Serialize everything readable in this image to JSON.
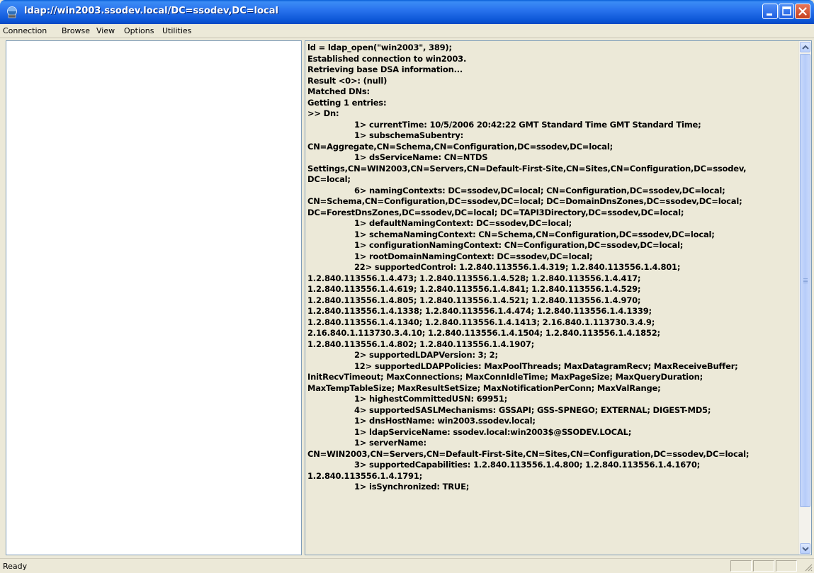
{
  "window": {
    "title": "ldap://win2003.ssodev.local/DC=ssodev,DC=local",
    "app_icon": "ldp-icon"
  },
  "menu": {
    "items": [
      "Connection",
      "Browse",
      "View",
      "Options",
      "Utilities"
    ]
  },
  "output": {
    "lines": [
      {
        "text": "ld = ldap_open(\"win2003\", 389);",
        "indent": false
      },
      {
        "text": "Established connection to win2003.",
        "indent": false
      },
      {
        "text": "Retrieving base DSA information...",
        "indent": false
      },
      {
        "text": "Result <0>: (null)",
        "indent": false
      },
      {
        "text": "Matched DNs:",
        "indent": false
      },
      {
        "text": "Getting 1 entries:",
        "indent": false
      },
      {
        "text": ">> Dn:",
        "indent": false
      },
      {
        "text": "1> currentTime: 10/5/2006 20:42:22 GMT Standard Time GMT Standard Time;",
        "indent": true
      },
      {
        "text": "1> subschemaSubentry:",
        "indent": true
      },
      {
        "text": "CN=Aggregate,CN=Schema,CN=Configuration,DC=ssodev,DC=local;",
        "indent": false
      },
      {
        "text": "1> dsServiceName: CN=NTDS",
        "indent": true
      },
      {
        "text": "Settings,CN=WIN2003,CN=Servers,CN=Default-First-Site,CN=Sites,CN=Configuration,DC=ssodev,",
        "indent": false
      },
      {
        "text": "DC=local;",
        "indent": false
      },
      {
        "text": "6> namingContexts: DC=ssodev,DC=local; CN=Configuration,DC=ssodev,DC=local;",
        "indent": true
      },
      {
        "text": "CN=Schema,CN=Configuration,DC=ssodev,DC=local; DC=DomainDnsZones,DC=ssodev,DC=local;",
        "indent": false
      },
      {
        "text": "DC=ForestDnsZones,DC=ssodev,DC=local; DC=TAPI3Directory,DC=ssodev,DC=local;",
        "indent": false
      },
      {
        "text": "1> defaultNamingContext: DC=ssodev,DC=local;",
        "indent": true
      },
      {
        "text": "1> schemaNamingContext: CN=Schema,CN=Configuration,DC=ssodev,DC=local;",
        "indent": true
      },
      {
        "text": "1> configurationNamingContext: CN=Configuration,DC=ssodev,DC=local;",
        "indent": true
      },
      {
        "text": "1> rootDomainNamingContext: DC=ssodev,DC=local;",
        "indent": true
      },
      {
        "text": "22> supportedControl: 1.2.840.113556.1.4.319; 1.2.840.113556.1.4.801;",
        "indent": true
      },
      {
        "text": "1.2.840.113556.1.4.473; 1.2.840.113556.1.4.528; 1.2.840.113556.1.4.417;",
        "indent": false
      },
      {
        "text": "1.2.840.113556.1.4.619; 1.2.840.113556.1.4.841; 1.2.840.113556.1.4.529;",
        "indent": false
      },
      {
        "text": "1.2.840.113556.1.4.805; 1.2.840.113556.1.4.521; 1.2.840.113556.1.4.970;",
        "indent": false
      },
      {
        "text": "1.2.840.113556.1.4.1338; 1.2.840.113556.1.4.474; 1.2.840.113556.1.4.1339;",
        "indent": false
      },
      {
        "text": "1.2.840.113556.1.4.1340; 1.2.840.113556.1.4.1413; 2.16.840.1.113730.3.4.9;",
        "indent": false
      },
      {
        "text": "2.16.840.1.113730.3.4.10; 1.2.840.113556.1.4.1504; 1.2.840.113556.1.4.1852;",
        "indent": false
      },
      {
        "text": "1.2.840.113556.1.4.802; 1.2.840.113556.1.4.1907;",
        "indent": false
      },
      {
        "text": "2> supportedLDAPVersion: 3; 2;",
        "indent": true
      },
      {
        "text": "12> supportedLDAPPolicies: MaxPoolThreads; MaxDatagramRecv; MaxReceiveBuffer;",
        "indent": true
      },
      {
        "text": "InitRecvTimeout; MaxConnections; MaxConnIdleTime; MaxPageSize; MaxQueryDuration;",
        "indent": false
      },
      {
        "text": "MaxTempTableSize; MaxResultSetSize; MaxNotificationPerConn; MaxValRange;",
        "indent": false
      },
      {
        "text": "1> highestCommittedUSN: 69951;",
        "indent": true
      },
      {
        "text": "4> supportedSASLMechanisms: GSSAPI; GSS-SPNEGO; EXTERNAL; DIGEST-MD5;",
        "indent": true
      },
      {
        "text": "1> dnsHostName: win2003.ssodev.local;",
        "indent": true
      },
      {
        "text": "1> ldapServiceName: ssodev.local:win2003$@SSODEV.LOCAL;",
        "indent": true
      },
      {
        "text": "1> serverName:",
        "indent": true
      },
      {
        "text": "CN=WIN2003,CN=Servers,CN=Default-First-Site,CN=Sites,CN=Configuration,DC=ssodev,DC=local;",
        "indent": false
      },
      {
        "text": "3> supportedCapabilities: 1.2.840.113556.1.4.800; 1.2.840.113556.1.4.1670;",
        "indent": true
      },
      {
        "text": "1.2.840.113556.1.4.1791;",
        "indent": false
      },
      {
        "text": "1> isSynchronized: TRUE;",
        "indent": true
      }
    ]
  },
  "statusbar": {
    "text": "Ready"
  }
}
